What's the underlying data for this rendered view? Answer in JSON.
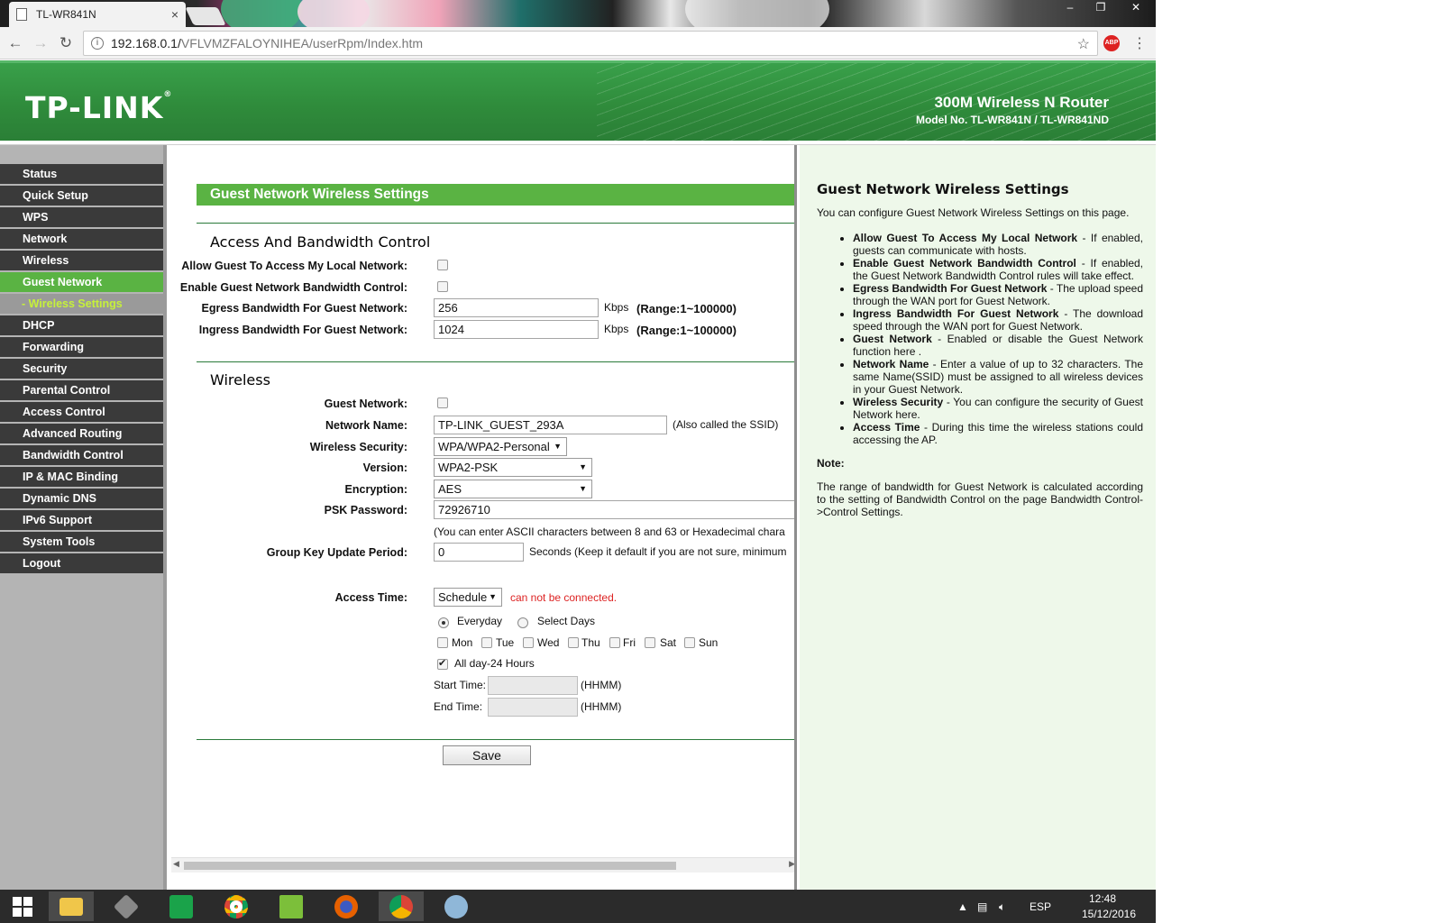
{
  "browser": {
    "tab_title": "TL-WR841N",
    "tab_close": "×",
    "url_host": "192.168.0.1/",
    "url_path": "VFLVMZFALOYNIHEA/userRpm/Index.htm",
    "abp_label": "ABP",
    "window_controls": [
      "–",
      "❐",
      "✕"
    ]
  },
  "header": {
    "logo": "TP-LINK",
    "logo_mark": "®",
    "product": "300M Wireless N Router",
    "model": "Model No. TL-WR841N / TL-WR841ND"
  },
  "sidebar": {
    "items": [
      {
        "label": "Status"
      },
      {
        "label": "Quick Setup"
      },
      {
        "label": "WPS"
      },
      {
        "label": "Network"
      },
      {
        "label": "Wireless"
      },
      {
        "label": "Guest Network"
      },
      {
        "label": "- Wireless Settings"
      },
      {
        "label": "DHCP"
      },
      {
        "label": "Forwarding"
      },
      {
        "label": "Security"
      },
      {
        "label": "Parental Control"
      },
      {
        "label": "Access Control"
      },
      {
        "label": "Advanced Routing"
      },
      {
        "label": "Bandwidth Control"
      },
      {
        "label": "IP & MAC Binding"
      },
      {
        "label": "Dynamic DNS"
      },
      {
        "label": "IPv6 Support"
      },
      {
        "label": "System Tools"
      },
      {
        "label": "Logout"
      }
    ]
  },
  "main": {
    "title": "Guest Network Wireless Settings",
    "access_section": {
      "title": "Access And Bandwidth Control",
      "allow_local_label": "Allow Guest To Access My Local Network:",
      "enable_bw_label": "Enable Guest Network Bandwidth Control:",
      "egress_label": "Egress Bandwidth For Guest Network:",
      "egress_value": "256",
      "ingress_label": "Ingress Bandwidth For Guest Network:",
      "ingress_value": "1024",
      "unit": "Kbps",
      "range": "(Range:1~100000)"
    },
    "wireless_section": {
      "title": "Wireless",
      "guest_network_label": "Guest Network:",
      "network_name_label": "Network Name:",
      "network_name_value": "TP-LINK_GUEST_293A",
      "ssid_note": "(Also called the SSID)",
      "security_label": "Wireless Security:",
      "security_value": "WPA/WPA2-Personal",
      "version_label": "Version:",
      "version_value": "WPA2-PSK",
      "encryption_label": "Encryption:",
      "encryption_value": "AES",
      "psk_label": "PSK Password:",
      "psk_value": "72926710",
      "psk_note": "(You can enter ASCII characters between 8 and 63 or Hexadecimal chara",
      "group_key_label": "Group Key Update Period:",
      "group_key_value": "0",
      "group_key_note": "Seconds (Keep it default if you are not sure, minimum",
      "access_time_label": "Access Time:",
      "access_time_value": "Schedule",
      "access_time_warning": "can not be connected.",
      "everyday_label": "Everyday",
      "select_days_label": "Select Days",
      "days": [
        "Mon",
        "Tue",
        "Wed",
        "Thu",
        "Fri",
        "Sat",
        "Sun"
      ],
      "all_day_label": "All day-24 Hours",
      "start_time_label": "Start Time:",
      "end_time_label": "End Time:",
      "hhmm": "(HHMM)"
    },
    "save_label": "Save"
  },
  "help": {
    "title": "Guest Network Wireless Settings",
    "intro": "You can configure Guest Network Wireless Settings on this page.",
    "items": [
      {
        "term": "Allow Guest To Access My Local Network",
        "desc": " - If enabled, guests can communicate with hosts."
      },
      {
        "term": "Enable Guest Network Bandwidth Control",
        "desc": " - If enabled, the Guest Network Bandwidth Control rules will take effect."
      },
      {
        "term": "Egress Bandwidth For Guest Network",
        "desc": " - The upload speed through the WAN port for Guest Network."
      },
      {
        "term": "Ingress Bandwidth For Guest Network",
        "desc": " - The download speed through the WAN port for Guest Network."
      },
      {
        "term": "Guest Network",
        "desc": " - Enabled or disable the Guest Network function here ."
      },
      {
        "term": "Network Name",
        "desc": " - Enter a value of up to 32 characters. The same Name(SSID) must be assigned to all wireless devices in your Guest Network."
      },
      {
        "term": "Wireless Security",
        "desc": " - You can configure the security of Guest Network here."
      },
      {
        "term": "Access Time",
        "desc": " - During this time the wireless stations could accessing the AP."
      }
    ],
    "note_title": "Note:",
    "note": "The range of bandwidth for Guest Network is calculated according to the setting of Bandwidth Control on the page Bandwidth Control->Control Settings."
  },
  "taskbar": {
    "lang": "ESP",
    "time": "12:48",
    "date": "15/12/2016"
  }
}
